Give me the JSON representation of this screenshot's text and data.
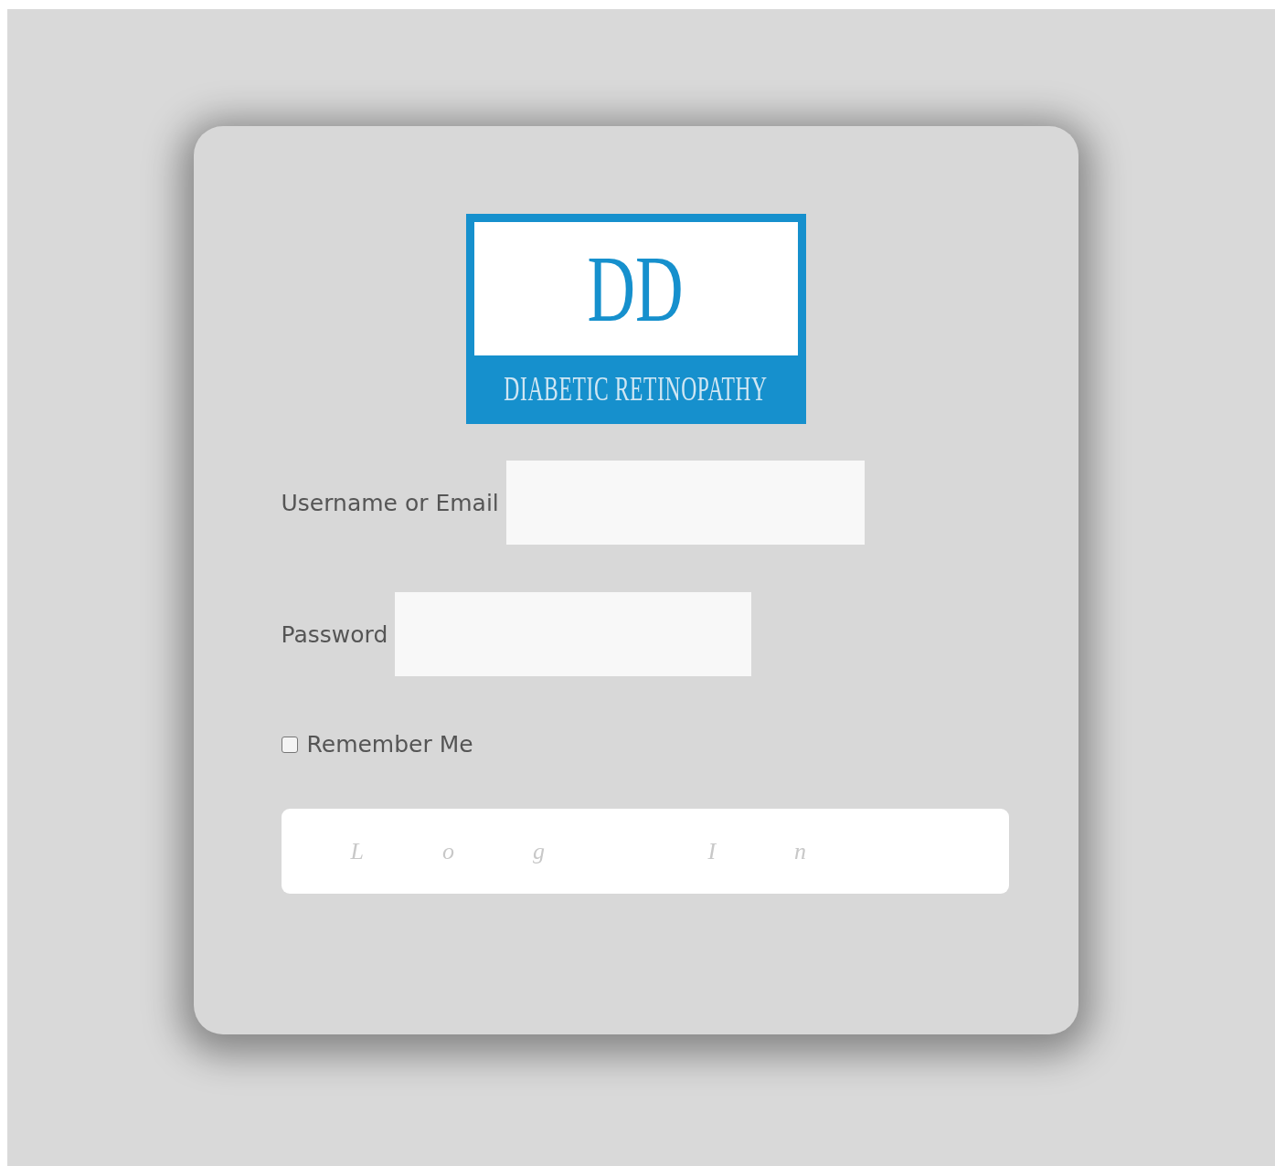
{
  "logo": {
    "monogram": "DD",
    "title": "DIABETIC RETINOPATHY"
  },
  "fields": [
    {
      "label": "Username or Email",
      "kind": "text"
    },
    {
      "label": "Password",
      "kind": "password"
    }
  ],
  "remember": {
    "label": "Remember Me",
    "checked": false
  },
  "submit": {
    "label": "Log In"
  }
}
